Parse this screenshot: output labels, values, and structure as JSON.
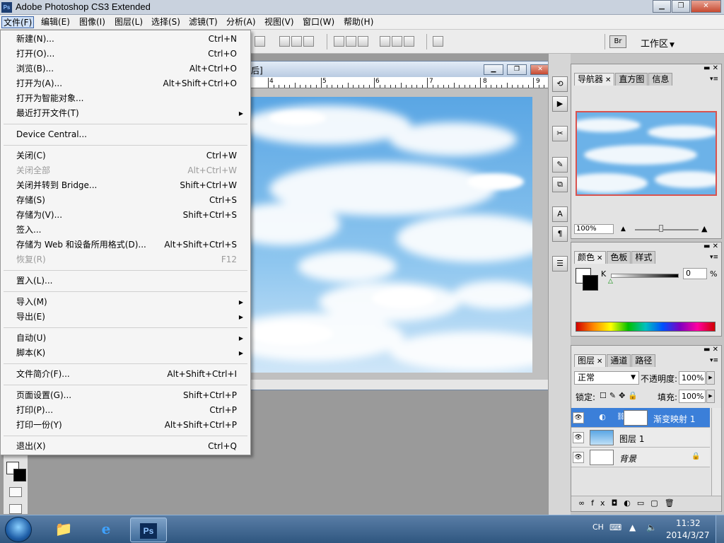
{
  "app": {
    "title": "Adobe Photoshop CS3 Extended",
    "logo": "Ps",
    "minimize": "▁",
    "maximize": "❐",
    "close": "✕"
  },
  "menubar": [
    {
      "label": "文件(F)",
      "active": true
    },
    {
      "label": "编辑(E)"
    },
    {
      "label": "图像(I)"
    },
    {
      "label": "图层(L)"
    },
    {
      "label": "选择(S)"
    },
    {
      "label": "滤镜(T)"
    },
    {
      "label": "分析(A)"
    },
    {
      "label": "视图(V)"
    },
    {
      "label": "窗口(W)"
    },
    {
      "label": "帮助(H)"
    }
  ],
  "options": {
    "workspace": "工作区",
    "workspace_arrow": "▼",
    "bridge_icon": "Br"
  },
  "document": {
    "title_fragment": "后]",
    "ruler": [
      "4",
      "5",
      "6",
      "7",
      "8",
      "9"
    ]
  },
  "file_menu": {
    "items": [
      {
        "label": "新建(N)...",
        "shortcut": "Ctrl+N"
      },
      {
        "label": "打开(O)...",
        "shortcut": "Ctrl+O"
      },
      {
        "label": "浏览(B)...",
        "shortcut": "Alt+Ctrl+O"
      },
      {
        "label": "打开为(A)...",
        "shortcut": "Alt+Shift+Ctrl+O"
      },
      {
        "label": "打开为智能对象...",
        "shortcut": ""
      },
      {
        "label": "最近打开文件(T)",
        "shortcut": "",
        "submenu": true
      },
      {
        "separator": true
      },
      {
        "label": "Device Central...",
        "shortcut": ""
      },
      {
        "separator": true
      },
      {
        "label": "关闭(C)",
        "shortcut": "Ctrl+W"
      },
      {
        "label": "关闭全部",
        "shortcut": "Alt+Ctrl+W",
        "disabled": true
      },
      {
        "label": "关闭并转到 Bridge...",
        "shortcut": "Shift+Ctrl+W"
      },
      {
        "label": "存储(S)",
        "shortcut": "Ctrl+S"
      },
      {
        "label": "存储为(V)...",
        "shortcut": "Shift+Ctrl+S"
      },
      {
        "label": "签入...",
        "shortcut": ""
      },
      {
        "label": "存储为 Web 和设备所用格式(D)...",
        "shortcut": "Alt+Shift+Ctrl+S"
      },
      {
        "label": "恢复(R)",
        "shortcut": "F12",
        "disabled": true
      },
      {
        "separator": true
      },
      {
        "label": "置入(L)...",
        "shortcut": ""
      },
      {
        "separator": true
      },
      {
        "label": "导入(M)",
        "shortcut": "",
        "submenu": true
      },
      {
        "label": "导出(E)",
        "shortcut": "",
        "submenu": true
      },
      {
        "separator": true
      },
      {
        "label": "自动(U)",
        "shortcut": "",
        "submenu": true
      },
      {
        "label": "脚本(K)",
        "shortcut": "",
        "submenu": true
      },
      {
        "separator": true
      },
      {
        "label": "文件简介(F)...",
        "shortcut": "Alt+Shift+Ctrl+I"
      },
      {
        "separator": true
      },
      {
        "label": "页面设置(G)...",
        "shortcut": "Shift+Ctrl+P"
      },
      {
        "label": "打印(P)...",
        "shortcut": "Ctrl+P"
      },
      {
        "label": "打印一份(Y)",
        "shortcut": "Alt+Shift+Ctrl+P"
      },
      {
        "separator": true
      },
      {
        "label": "退出(X)",
        "shortcut": "Ctrl+Q"
      }
    ],
    "submenu_arrow": "▶"
  },
  "navigator_panel": {
    "tabs": [
      "导航器",
      "直方图",
      "信息"
    ],
    "zoom": "100%"
  },
  "color_panel": {
    "tabs": [
      "颜色",
      "色板",
      "样式"
    ],
    "channel": "K",
    "value": "0",
    "unit": "%"
  },
  "layers_panel": {
    "tabs": [
      "图层",
      "通道",
      "路径"
    ],
    "blend_mode": "正常",
    "opacity_label": "不透明度:",
    "opacity": "100%",
    "lock_label": "锁定:",
    "fill_label": "填充:",
    "fill": "100%",
    "layers": [
      {
        "name": "渐变映射 1",
        "selected": true
      },
      {
        "name": "图层 1"
      },
      {
        "name": "背景",
        "italic": true,
        "locked": true
      }
    ],
    "footer_icons": [
      "link-icon",
      "fx-icon",
      "mask-icon",
      "adjustment-icon",
      "group-icon",
      "new-layer-icon",
      "trash-icon"
    ]
  },
  "taskbar": {
    "lang": "CH",
    "time": "11:32",
    "date": "2014/3/27",
    "ps_label": "Ps"
  }
}
